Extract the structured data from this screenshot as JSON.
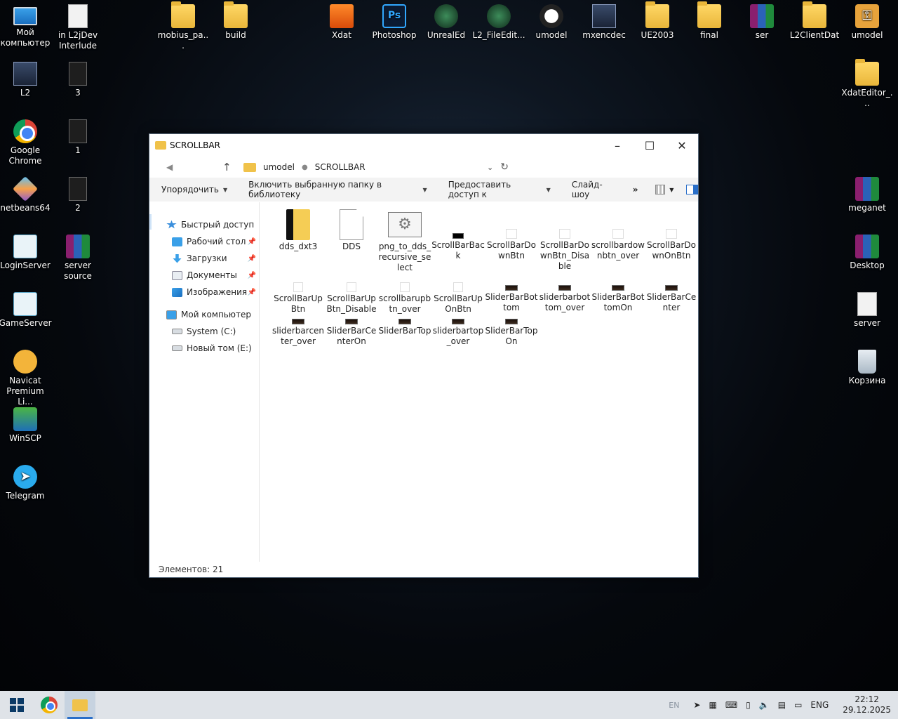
{
  "desktop": {
    "icons": [
      {
        "label": "Мой компьютер",
        "icon": "computer-icon"
      },
      {
        "label": "in L2jDev Interlude",
        "icon": "document-icon"
      },
      {
        "label": "mobius_pa...",
        "icon": "folder-icon"
      },
      {
        "label": "build",
        "icon": "folder-icon"
      },
      {
        "label": "Xdat",
        "icon": "xdat-icon"
      },
      {
        "label": "Photoshop",
        "icon": "photoshop-icon"
      },
      {
        "label": "UnrealEd",
        "icon": "unreal-ed-icon"
      },
      {
        "label": "L2_FileEdit...",
        "icon": "l2-fileedit-icon"
      },
      {
        "label": "umodel",
        "icon": "umodel-icon"
      },
      {
        "label": "mxencdec",
        "icon": "mxencdec-icon"
      },
      {
        "label": "UE2003",
        "icon": "folder-icon"
      },
      {
        "label": "final",
        "icon": "folder-icon"
      },
      {
        "label": "ser",
        "icon": "archive-icon"
      },
      {
        "label": "L2ClientDat",
        "icon": "folder-icon"
      },
      {
        "label": "umodel",
        "icon": "key-icon"
      },
      {
        "label": "L2",
        "icon": "lineage-icon"
      },
      {
        "label": "3",
        "icon": "dark-file-icon"
      },
      {
        "label": "XdatEditor_...",
        "icon": "folder-icon"
      },
      {
        "label": "Google Chrome",
        "icon": "chrome-icon"
      },
      {
        "label": "1",
        "icon": "dark-file-icon"
      },
      {
        "label": "netbeans64",
        "icon": "netbeans-icon"
      },
      {
        "label": "2",
        "icon": "dark-file-icon"
      },
      {
        "label": "meganet",
        "icon": "archive-icon"
      },
      {
        "label": "LoginServer",
        "icon": "script-icon"
      },
      {
        "label": "server source",
        "icon": "archive-icon"
      },
      {
        "label": "Desktop",
        "icon": "archive-icon"
      },
      {
        "label": "GameServer",
        "icon": "script-icon"
      },
      {
        "label": "server",
        "icon": "document-icon"
      },
      {
        "label": "Navicat Premium Li...",
        "icon": "navicat-icon"
      },
      {
        "label": "Корзина",
        "icon": "recycle-bin-icon"
      },
      {
        "label": "WinSCP",
        "icon": "winscp-icon"
      },
      {
        "label": "Telegram",
        "icon": "telegram-icon"
      }
    ]
  },
  "window": {
    "title": "SCROLLBAR",
    "breadcrumb": [
      "umodel",
      "SCROLLBAR"
    ],
    "toolbar": {
      "organize": "Упорядочить",
      "include_library": "Включить выбранную папку в библиотеку",
      "share": "Предоставить доступ к",
      "slideshow": "Слайд-шоу",
      "more": "»"
    },
    "nav": {
      "quick_access": "Быстрый доступ",
      "desktop": "Рабочий стол",
      "downloads": "Загрузки",
      "documents": "Документы",
      "images": "Изображения",
      "my_computer": "Мой компьютер",
      "drive_c": "System (C:)",
      "drive_e": "Новый том (E:)"
    },
    "files": [
      {
        "name": "dds_dxt3",
        "type": "folder"
      },
      {
        "name": "DDS",
        "type": "blank"
      },
      {
        "name": "png_to_dds_recursive_select",
        "type": "gear"
      },
      {
        "name": "ScrollBarBack",
        "type": "small-black"
      },
      {
        "name": "ScrollBarDownBtn",
        "type": "small-white"
      },
      {
        "name": "ScrollBarDownBtn_Disable",
        "type": "small-white"
      },
      {
        "name": "scrollbardownbtn_over",
        "type": "small-white"
      },
      {
        "name": "ScrollBarDownOnBtn",
        "type": "small-white"
      },
      {
        "name": "ScrollBarUpBtn",
        "type": "tiny-white"
      },
      {
        "name": "ScrollBarUpBtn_Disable",
        "type": "tiny-white"
      },
      {
        "name": "scrollbarupbtn_over",
        "type": "tiny-white"
      },
      {
        "name": "ScrollBarUpOnBtn",
        "type": "tiny-white"
      },
      {
        "name": "SliderBarBottom",
        "type": "tiny-dark"
      },
      {
        "name": "sliderbarbottom_over",
        "type": "tiny-dark"
      },
      {
        "name": "SliderBarBottomOn",
        "type": "tiny-dark"
      },
      {
        "name": "SliderBarCenter",
        "type": "tiny-dark"
      },
      {
        "name": "sliderbarcenter_over",
        "type": "tiny-dark"
      },
      {
        "name": "SliderBarCenterOn",
        "type": "tiny-dark"
      },
      {
        "name": "SliderBarTop",
        "type": "tiny-dark"
      },
      {
        "name": "sliderbartop_over",
        "type": "tiny-dark"
      },
      {
        "name": "SliderBarTopOn",
        "type": "tiny-dark"
      }
    ],
    "status": "Элементов: 21"
  },
  "taskbar": {
    "input_indicator": "EN",
    "language": "ENG",
    "time": "22:12",
    "date": "29.12.2025"
  }
}
